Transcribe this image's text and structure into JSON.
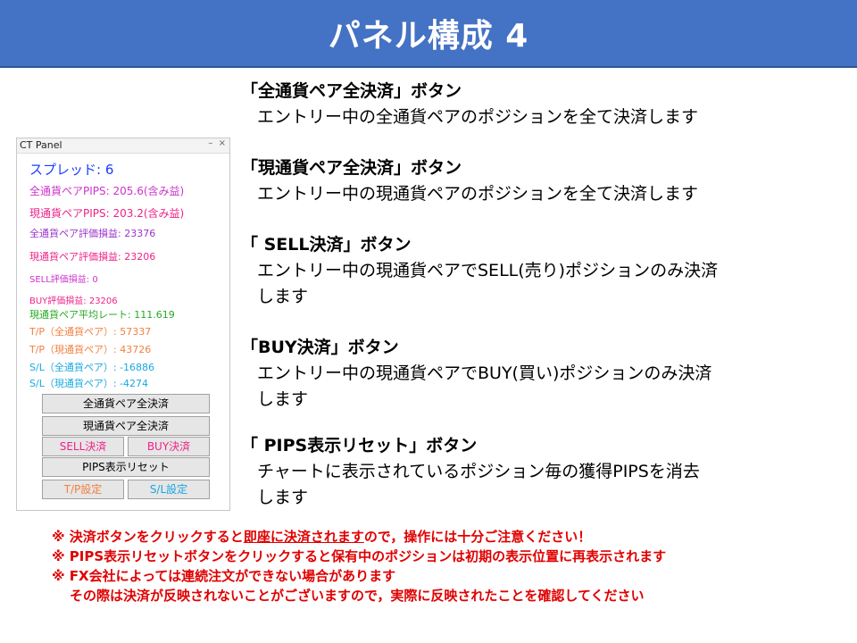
{
  "header": {
    "title": "パネル構成 4"
  },
  "panel": {
    "title": "CT Panel",
    "controls": [
      "–",
      "×"
    ],
    "spread": "スプレッド: 6",
    "lines": [
      {
        "text": "全通貨ペアPIPS: 205.6(含み益)",
        "color": "#cc33cc"
      },
      {
        "text": "現通貨ペアPIPS: 203.2(含み益)",
        "color": "#ee2288"
      },
      {
        "text": "全通貨ペア評価損益: 23376",
        "color": "#9933cc"
      },
      {
        "text": "現通貨ペア評価損益: 23206",
        "color": "#ee2288"
      },
      {
        "text": "SELL評価損益: 0",
        "color": "#cc33cc"
      },
      {
        "text": "BUY評価損益: 23206",
        "color": "#ee2288"
      },
      {
        "text": "現通貨ペア平均レート: 111.619",
        "color": "#22aa22"
      },
      {
        "text": "T/P（全通貨ペア）: 57337",
        "color": "#f08040"
      },
      {
        "text": "T/P（現通貨ペア）: 43726",
        "color": "#f08040"
      },
      {
        "text": "S/L（全通貨ペア）: -16886",
        "color": "#1aa7e0"
      },
      {
        "text": "S/L（現通貨ペア）: -4274",
        "color": "#1aa7e0"
      }
    ],
    "buttons": {
      "all_close": "全通貨ペア全決済",
      "current_close": "現通貨ペア全決済",
      "sell_close": "SELL決済",
      "buy_close": "BUY決済",
      "pips_reset": "PIPS表示リセット",
      "tp_setting": "T/P設定",
      "sl_setting": "S/L設定"
    },
    "colors": {
      "sell_close": "#ee2288",
      "buy_close": "#ee2288",
      "tp_setting": "#f08040",
      "sl_setting": "#1aa7e0"
    }
  },
  "descriptions": [
    {
      "head": "「全通貨ペア全決済」ボタン",
      "body": [
        "エントリー中の全通貨ペアのポジションを全て決済します"
      ]
    },
    {
      "head": "「現通貨ペア全決済」ボタン",
      "body": [
        "エントリー中の現通貨ペアのポジションを全て決済します"
      ]
    },
    {
      "head": "「 SELL決済」ボタン",
      "body": [
        "エントリー中の現通貨ペアでSELL(売り)ポジションのみ決済",
        "します"
      ]
    },
    {
      "head": "「BUY決済」ボタン",
      "body": [
        "エントリー中の現通貨ペアでBUY(買い)ポジションのみ決済",
        "します"
      ]
    },
    {
      "head": "「 PIPS表示リセット」ボタン",
      "body": [
        "チャートに表示されているポジション毎の獲得PIPSを消去",
        "します"
      ]
    }
  ],
  "notes": {
    "line1_pre": "※ 決済ボタンをクリックすると",
    "line1_underlined": "即座に決済されます",
    "line1_post": "ので，操作には十分ご注意ください！",
    "line2": "※ PIPS表示リセットボタンをクリックすると保有中のポジションは初期の表示位置に再表示されます",
    "line3": "※ FX会社によっては連続注文ができない場合があります",
    "line4": "その際は決済が反映されないことがございますので，実際に反映されたことを確認してください"
  }
}
